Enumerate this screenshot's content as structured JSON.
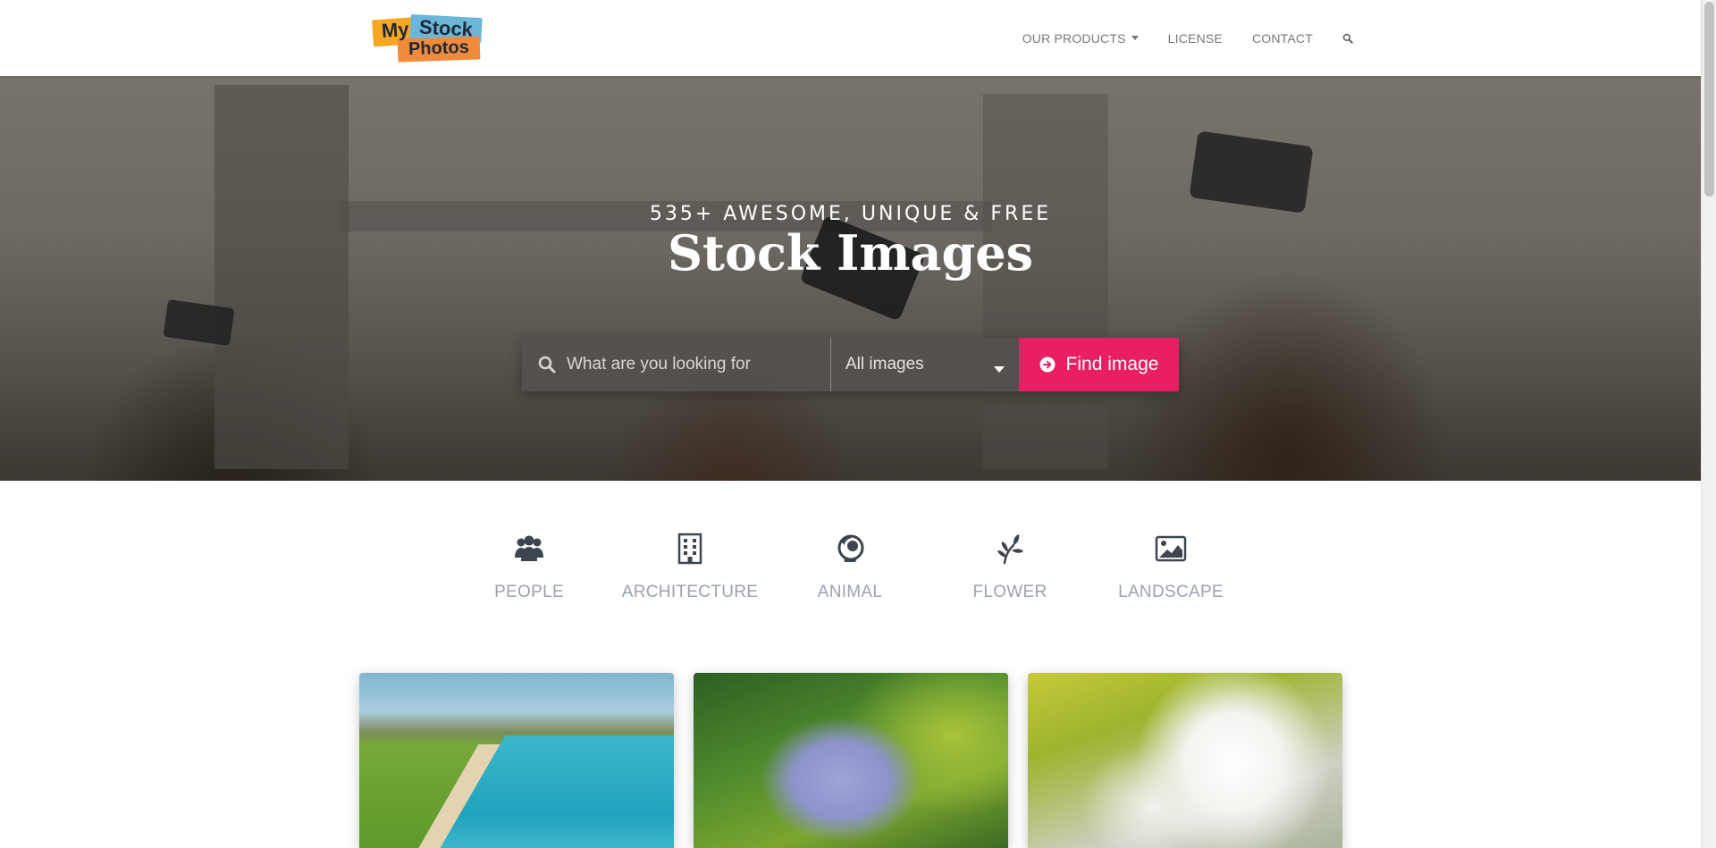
{
  "logo": {
    "line1_left": "My",
    "line1_right": "Stock",
    "line2": "Photos"
  },
  "nav": {
    "items": [
      {
        "label": "OUR PRODUCTS",
        "has_dropdown": true
      },
      {
        "label": "LICENSE"
      },
      {
        "label": "CONTACT"
      }
    ],
    "search_icon": "search-icon"
  },
  "hero": {
    "subtitle": "535+ AWESOME, UNIQUE & FREE",
    "title": "Stock Images"
  },
  "search": {
    "placeholder": "What are you looking for",
    "value": "",
    "category_selected": "All images",
    "button_label": "Find image",
    "button_icon": "arrow-circle-right-icon",
    "accent_color": "#e91e63"
  },
  "categories": [
    {
      "label": "PEOPLE",
      "icon": "people-icon"
    },
    {
      "label": "ARCHITECTURE",
      "icon": "building-icon"
    },
    {
      "label": "ANIMAL",
      "icon": "animal-icon"
    },
    {
      "label": "FLOWER",
      "icon": "flower-icon"
    },
    {
      "label": "LANDSCAPE",
      "icon": "landscape-icon"
    }
  ],
  "gallery": [
    {
      "subject": "beach"
    },
    {
      "subject": "lilac-purple"
    },
    {
      "subject": "lilac-white"
    }
  ]
}
